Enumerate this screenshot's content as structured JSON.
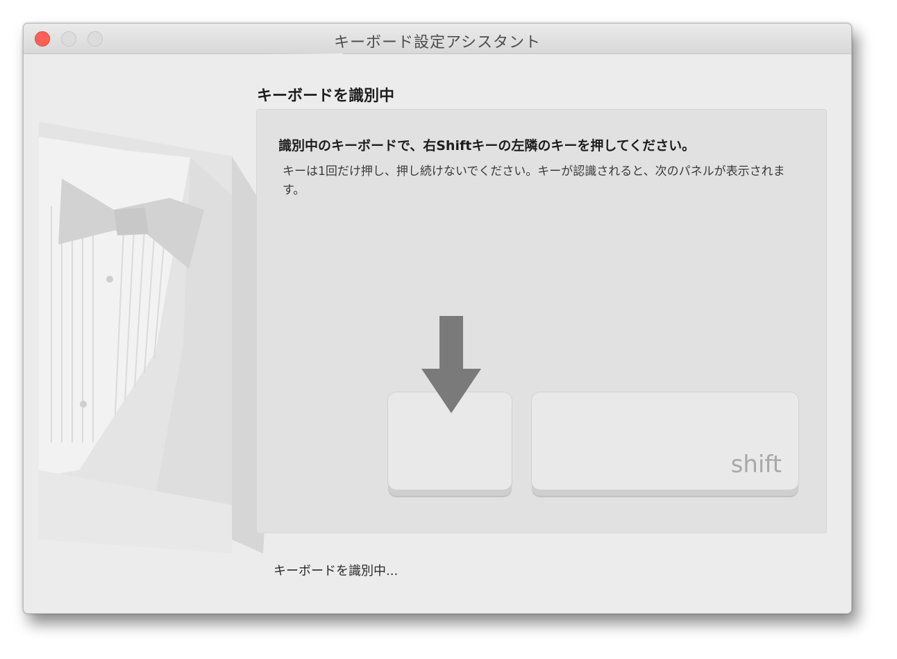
{
  "window": {
    "title": "キーボード設定アシスタント"
  },
  "main": {
    "heading": "キーボードを識別中",
    "instruction": "識別中のキーボードで、右Shiftキーの左隣のキーを押してください。",
    "note": "キーは1回だけ押し、押し続けないでください。キーが認識されると、次のパネルが表示されます。",
    "keys": {
      "left_key_label": "",
      "shift_key_label": "shift"
    }
  },
  "status": {
    "text": "キーボードを識別中..."
  },
  "icons": {
    "close": "close-button-icon",
    "minimize": "minimize-button-icon",
    "zoom": "zoom-button-icon",
    "arrow": "arrow-down-icon",
    "illustration": "tuxedo-illustration"
  },
  "colors": {
    "close": "#fe5f57",
    "window_bg": "#ececec",
    "panel_bg": "#e1e1e1",
    "arrow": "#7a7a7a"
  }
}
